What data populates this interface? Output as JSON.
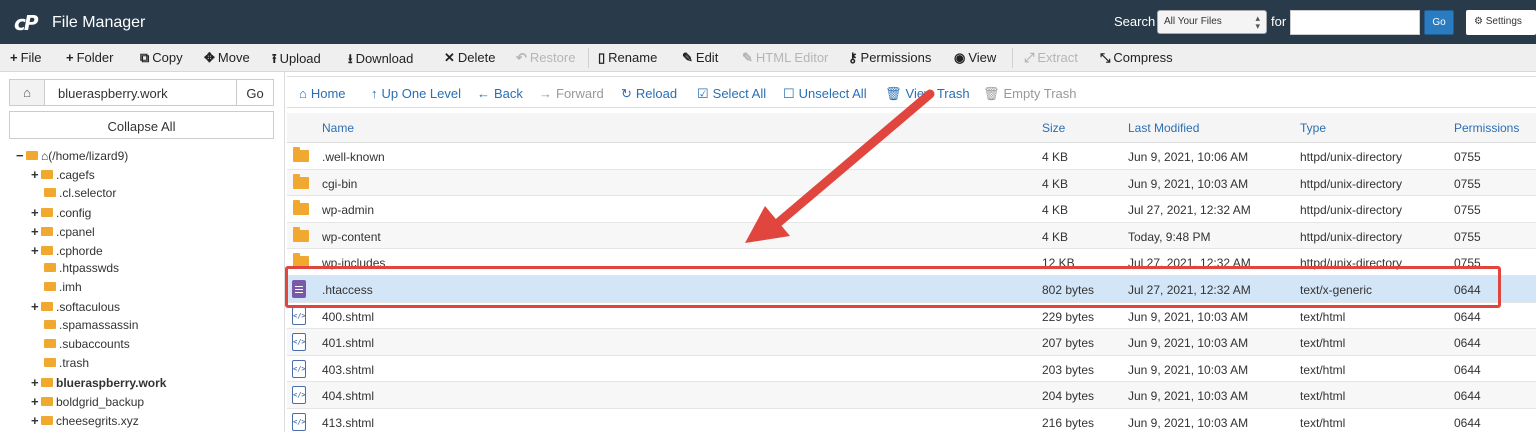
{
  "header": {
    "app_title": "File Manager",
    "search_label": "Search",
    "search_scope": "All Your Files",
    "for_label": "for",
    "search_placeholder": "",
    "go_label": "Go",
    "settings_label": "Settings"
  },
  "toolbar": {
    "file": "File",
    "folder": "Folder",
    "copy": "Copy",
    "move": "Move",
    "upload": "Upload",
    "download": "Download",
    "delete": "Delete",
    "restore": "Restore",
    "rename": "Rename",
    "edit": "Edit",
    "html_editor": "HTML Editor",
    "permissions": "Permissions",
    "view": "View",
    "extract": "Extract",
    "compress": "Compress"
  },
  "left": {
    "path_value": "blueraspberry.work",
    "go_label": "Go",
    "collapse_label": "Collapse All",
    "tree": [
      {
        "label": "(/home/lizard9)",
        "prefix": "−",
        "bold": false
      },
      {
        "label": ".cagefs",
        "prefix": "+",
        "bold": false
      },
      {
        "label": ".cl.selector",
        "prefix": "",
        "bold": false
      },
      {
        "label": ".config",
        "prefix": "+",
        "bold": false
      },
      {
        "label": ".cpanel",
        "prefix": "+",
        "bold": false
      },
      {
        "label": ".cphorde",
        "prefix": "+",
        "bold": false
      },
      {
        "label": ".htpasswds",
        "prefix": "",
        "bold": false
      },
      {
        "label": ".imh",
        "prefix": "",
        "bold": false
      },
      {
        "label": ".softaculous",
        "prefix": "+",
        "bold": false
      },
      {
        "label": ".spamassassin",
        "prefix": "",
        "bold": false
      },
      {
        "label": ".subaccounts",
        "prefix": "",
        "bold": false
      },
      {
        "label": ".trash",
        "prefix": "",
        "bold": false
      },
      {
        "label": "blueraspberry.work",
        "prefix": "+",
        "bold": true
      },
      {
        "label": "boldgrid_backup",
        "prefix": "+",
        "bold": false
      },
      {
        "label": "cheesegrits.xyz",
        "prefix": "+",
        "bold": false
      }
    ]
  },
  "nav": {
    "home": "Home",
    "up": "Up One Level",
    "back": "Back",
    "forward": "Forward",
    "reload": "Reload",
    "select_all": "Select All",
    "unselect_all": "Unselect All",
    "view_trash": "View Trash",
    "empty_trash": "Empty Trash"
  },
  "table": {
    "headers": {
      "name": "Name",
      "size": "Size",
      "modified": "Last Modified",
      "type": "Type",
      "perms": "Permissions"
    },
    "rows": [
      {
        "icon": "folder",
        "name": ".well-known",
        "size": "4 KB",
        "modified": "Jun 9, 2021, 10:06 AM",
        "type": "httpd/unix-directory",
        "perms": "0755"
      },
      {
        "icon": "folder",
        "name": "cgi-bin",
        "size": "4 KB",
        "modified": "Jun 9, 2021, 10:03 AM",
        "type": "httpd/unix-directory",
        "perms": "0755"
      },
      {
        "icon": "folder",
        "name": "wp-admin",
        "size": "4 KB",
        "modified": "Jul 27, 2021, 12:32 AM",
        "type": "httpd/unix-directory",
        "perms": "0755"
      },
      {
        "icon": "folder",
        "name": "wp-content",
        "size": "4 KB",
        "modified": "Today, 9:48 PM",
        "type": "httpd/unix-directory",
        "perms": "0755"
      },
      {
        "icon": "folder",
        "name": "wp-includes",
        "size": "12 KB",
        "modified": "Jul 27, 2021, 12:32 AM",
        "type": "httpd/unix-directory",
        "perms": "0755"
      },
      {
        "icon": "doc",
        "name": ".htaccess",
        "size": "802 bytes",
        "modified": "Jul 27, 2021, 12:32 AM",
        "type": "text/x-generic",
        "perms": "0644"
      },
      {
        "icon": "html",
        "name": "400.shtml",
        "size": "229 bytes",
        "modified": "Jun 9, 2021, 10:03 AM",
        "type": "text/html",
        "perms": "0644"
      },
      {
        "icon": "html",
        "name": "401.shtml",
        "size": "207 bytes",
        "modified": "Jun 9, 2021, 10:03 AM",
        "type": "text/html",
        "perms": "0644"
      },
      {
        "icon": "html",
        "name": "403.shtml",
        "size": "203 bytes",
        "modified": "Jun 9, 2021, 10:03 AM",
        "type": "text/html",
        "perms": "0644"
      },
      {
        "icon": "html",
        "name": "404.shtml",
        "size": "204 bytes",
        "modified": "Jun 9, 2021, 10:03 AM",
        "type": "text/html",
        "perms": "0644"
      },
      {
        "icon": "html",
        "name": "413.shtml",
        "size": "216 bytes",
        "modified": "Jun 9, 2021, 10:03 AM",
        "type": "text/html",
        "perms": "0644"
      }
    ],
    "selected_index": 5
  },
  "colors": {
    "header_bg": "#293a4a",
    "accent": "#2a7bc0",
    "link": "#2a6fb5",
    "highlight": "#e0463e",
    "folder": "#f0a830"
  }
}
